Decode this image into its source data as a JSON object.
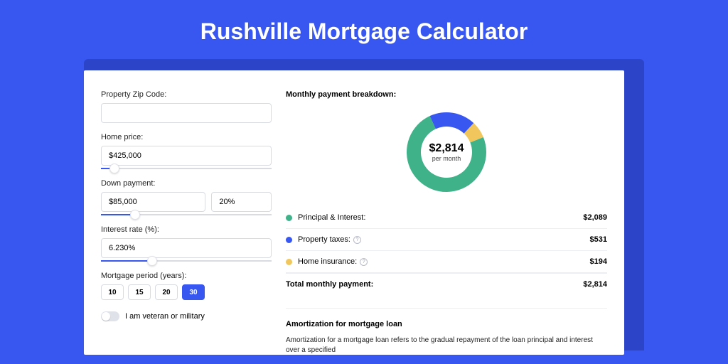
{
  "title": "Rushville Mortgage Calculator",
  "form": {
    "zip_label": "Property Zip Code:",
    "zip_value": "",
    "home_label": "Home price:",
    "home_value": "$425,000",
    "home_slider_pct": 8,
    "down_label": "Down payment:",
    "down_value": "$85,000",
    "down_pct_value": "20%",
    "down_slider_pct": 20,
    "rate_label": "Interest rate (%):",
    "rate_value": "6.230%",
    "rate_slider_pct": 30,
    "period_label": "Mortgage period (years):",
    "periods": [
      "10",
      "15",
      "20",
      "30"
    ],
    "period_active_index": 3,
    "veteran_label": "I am veteran or military"
  },
  "breakdown": {
    "heading": "Monthly payment breakdown:",
    "center_value": "$2,814",
    "center_sub": "per month",
    "items": [
      {
        "label": "Principal & Interest:",
        "amount": "$2,089",
        "color": "green",
        "info": false
      },
      {
        "label": "Property taxes:",
        "amount": "$531",
        "color": "blue",
        "info": true
      },
      {
        "label": "Home insurance:",
        "amount": "$194",
        "color": "yellow",
        "info": true
      }
    ],
    "total_label": "Total monthly payment:",
    "total_amount": "$2,814"
  },
  "chart_data": {
    "type": "pie",
    "title": "Monthly payment breakdown",
    "series": [
      {
        "name": "Principal & Interest",
        "value": 2089,
        "color": "#3fb28a"
      },
      {
        "name": "Property taxes",
        "value": 531,
        "color": "#3857f0"
      },
      {
        "name": "Home insurance",
        "value": 194,
        "color": "#f1c75d"
      }
    ],
    "total": 2814
  },
  "amortization": {
    "heading": "Amortization for mortgage loan",
    "body": "Amortization for a mortgage loan refers to the gradual repayment of the loan principal and interest over a specified"
  }
}
